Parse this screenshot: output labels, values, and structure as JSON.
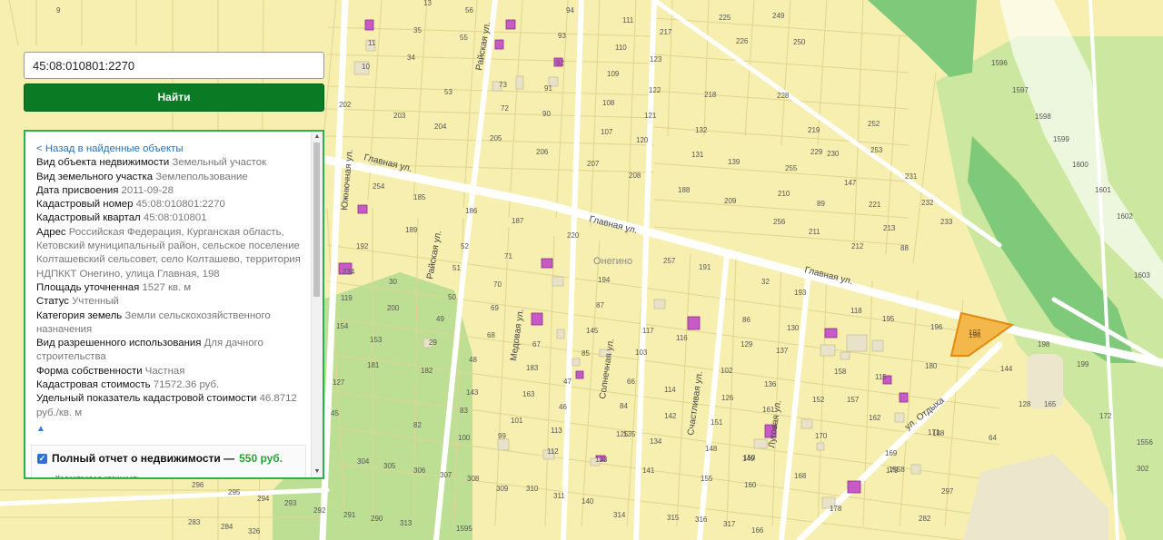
{
  "search": {
    "query": "45:08:010801:2270",
    "button_label": "Найти"
  },
  "info": {
    "back_link": "< Назад в найденные объекты",
    "rows": [
      {
        "label": "Вид объекта недвижимости",
        "value": "Земельный участок"
      },
      {
        "label": "Вид земельного участка",
        "value": "Землепользование"
      },
      {
        "label": "Дата присвоения",
        "value": "2011-09-28"
      },
      {
        "label": "Кадастровый номер",
        "value": "45:08:010801:2270"
      },
      {
        "label": "Кадастровый квартал",
        "value": "45:08:010801"
      },
      {
        "label": "Адрес",
        "value": "Российская Федерация, Курганская область, Кетовский муниципальный район, сельское поселение Колташевский сельсовет, село Колташево, территория НДПККТ Онегино, улица Главная, 198"
      },
      {
        "label": "Площадь уточненная",
        "value": "1527 кв. м"
      },
      {
        "label": "Статус",
        "value": "Учтенный"
      },
      {
        "label": "Категория земель",
        "value": "Земли сельскохозяйственного назначения"
      },
      {
        "label": "Вид разрешенного использования",
        "value": "Для дачного строительства"
      },
      {
        "label": "Форма собственности",
        "value": "Частная"
      },
      {
        "label": "Кадастровая стоимость",
        "value": "71572.36 руб."
      },
      {
        "label": "Удельный показатель кадастровой стоимости",
        "value": "46.8712 руб./кв. м"
      }
    ],
    "collapse_icon": "▲",
    "report": {
      "title": "Полный отчет о недвижимости —",
      "price": "550 руб.",
      "items": [
        "Кадастровая стоимость,"
      ]
    }
  },
  "map": {
    "colors": {
      "land": "#f7efb0",
      "roads": "#ffffff",
      "parcel_border": "#e0d490",
      "green": "#b3dc8e",
      "forest": "#7ec97a",
      "highlight": "#f0a020",
      "building": "#c75ac7"
    },
    "streets": [
      "Главная ул.",
      "Главная ул.",
      "Главная ул.",
      "Райская ул.",
      "Райская ул.",
      "Южнючная ул.",
      "Медовая ул.",
      "Солнечная ул.",
      "Счастливая ул.",
      "Луговая ул.",
      "ул. Отдыха"
    ],
    "place_label": "Онегино",
    "selected_parcel": "198",
    "parcels": [
      "9",
      "13",
      "35",
      "56",
      "94",
      "111",
      "217",
      "225",
      "249",
      "11",
      "55",
      "93",
      "110",
      "123",
      "226",
      "250",
      "10",
      "34",
      "92",
      "109",
      "122",
      "228",
      "218",
      "53",
      "91",
      "108",
      "121",
      "202",
      "203",
      "204",
      "73",
      "72",
      "90",
      "107",
      "120",
      "132",
      "219",
      "252",
      "205",
      "206",
      "207",
      "208",
      "131",
      "139",
      "229",
      "253",
      "230",
      "254",
      "185",
      "186",
      "187",
      "188",
      "209",
      "210",
      "147",
      "231",
      "255",
      "220",
      "189",
      "52",
      "71",
      "89",
      "221",
      "232",
      "256",
      "211",
      "212",
      "213",
      "233",
      "257",
      "191",
      "192",
      "51",
      "70",
      "88",
      "234",
      "32",
      "193",
      "194",
      "119",
      "30",
      "50",
      "69",
      "87",
      "118",
      "195",
      "196",
      "197",
      "198",
      "199",
      "200",
      "49",
      "68",
      "86",
      "145",
      "117",
      "130",
      "154",
      "153",
      "29",
      "48",
      "67",
      "85",
      "103",
      "116",
      "129",
      "137",
      "158",
      "180",
      "144",
      "128",
      "165",
      "172",
      "181",
      "182",
      "183",
      "47",
      "66",
      "102",
      "115",
      "127",
      "143",
      "163",
      "46",
      "84",
      "114",
      "126",
      "136",
      "152",
      "157",
      "162",
      "171",
      "45",
      "83",
      "101",
      "113",
      "135",
      "142",
      "151",
      "161",
      "170",
      "188",
      "64",
      "82",
      "100",
      "125",
      "134",
      "150",
      "149",
      "169",
      "1556",
      "99",
      "112",
      "133",
      "141",
      "148",
      "160",
      "1558",
      "302",
      "303",
      "304",
      "305",
      "306",
      "307",
      "308",
      "309",
      "310",
      "311",
      "140",
      "155",
      "168",
      "179",
      "297",
      "296",
      "295",
      "294",
      "293",
      "292",
      "291",
      "290",
      "313",
      "314",
      "315",
      "316",
      "317",
      "166",
      "178",
      "282",
      "283",
      "284",
      "326",
      "1595",
      "1596",
      "1597",
      "1598",
      "1599",
      "1600",
      "1601",
      "1602",
      "1603"
    ]
  }
}
